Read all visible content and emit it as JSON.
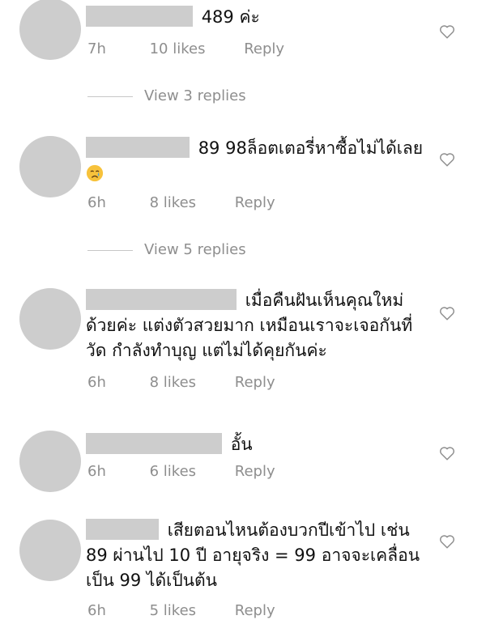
{
  "comments": [
    {
      "text": "489 ค่ะ",
      "time": "7h",
      "likes": "10 likes",
      "reply": "Reply",
      "view_replies": "View 3 replies"
    },
    {
      "text": "89 98ล็อตเตอรี่หาซื้อไม่ได้เลย",
      "emoji": "crying-face-emoji",
      "time": "6h",
      "likes": "8 likes",
      "reply": "Reply",
      "view_replies": "View 5 replies"
    },
    {
      "text": "เมื่อคืนฝันเห็นคุณใหม่ด้วยค่ะ แต่งตัวสวยมาก เหมือนเราจะเจอกันที่วัด กำลังทำบุญ แต่ไม่ได้คุยกันค่ะ",
      "time": "6h",
      "likes": "8 likes",
      "reply": "Reply"
    },
    {
      "text": "อั้น",
      "time": "6h",
      "likes": "6 likes",
      "reply": "Reply"
    },
    {
      "text": "เสียตอนไหนต้องบวกปีเข้าไป เช่น 89 ผ่านไป 10 ปี อายุจริง = 99 อาจจะเคลื่อนเป็น 99 ได้เป็นต้น",
      "time": "6h",
      "likes": "5 likes",
      "reply": "Reply"
    }
  ],
  "colors": {
    "avatar": "#cdcdcd",
    "redaction": "#cdcdcd",
    "meta_text": "#8e8e8e",
    "text": "#111111"
  },
  "icons": {
    "like": "heart-outline-icon"
  }
}
